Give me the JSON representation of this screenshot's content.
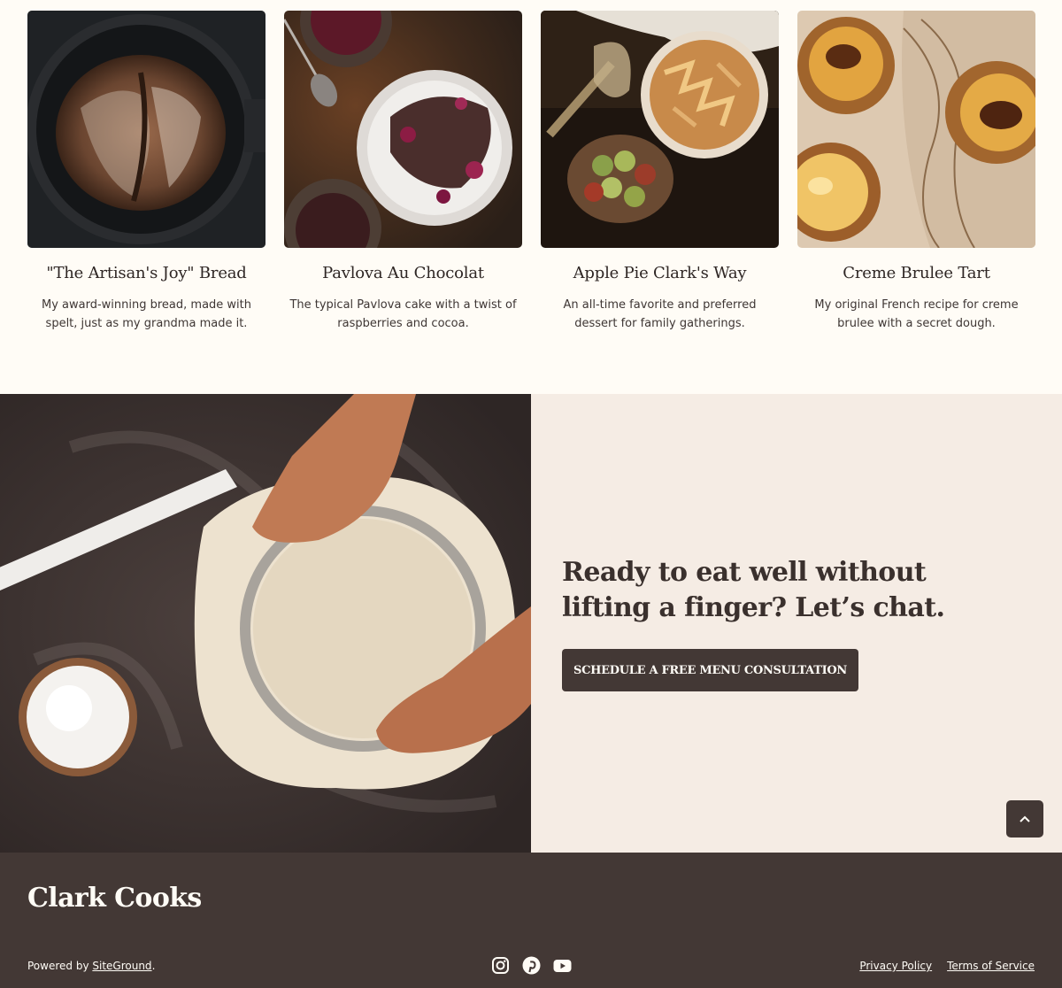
{
  "recipes": [
    {
      "title": "\"The Artisan's Joy\" Bread",
      "description": "My award-winning bread, made with spelt, just as my grandma made it.",
      "image_icon": "bread-photo"
    },
    {
      "title": "Pavlova Au Chocolat",
      "description": "The typical Pavlova cake with a twist of raspberries and cocoa.",
      "image_icon": "pavlova-photo"
    },
    {
      "title": "Apple Pie Clark's Way",
      "description": "An all-time favorite and preferred dessert for family gatherings.",
      "image_icon": "apple-pie-photo"
    },
    {
      "title": "Creme Brulee Tart",
      "description": "My original French recipe for creme brulee with a secret dough.",
      "image_icon": "creme-brulee-photo"
    }
  ],
  "cta": {
    "heading": "Ready to eat well without lifting a finger? Let’s chat.",
    "button_label": "SCHEDULE A FREE MENU CONSULTATION",
    "photo_icon": "dough-rolling-photo"
  },
  "back_to_top_icon": "chevron-up-icon",
  "footer": {
    "brand": "Clark Cooks",
    "powered_prefix": "Powered by ",
    "powered_link": "SiteGround",
    "powered_suffix": ".",
    "social_icons": [
      "instagram-icon",
      "pinterest-icon",
      "youtube-icon"
    ],
    "links": {
      "privacy": "Privacy Policy",
      "terms": "Terms of Service"
    }
  },
  "colors": {
    "page_bg": "#fffcf6",
    "panel_bg": "#f5ece4",
    "dark_brown": "#433835",
    "text": "#3e3634"
  }
}
